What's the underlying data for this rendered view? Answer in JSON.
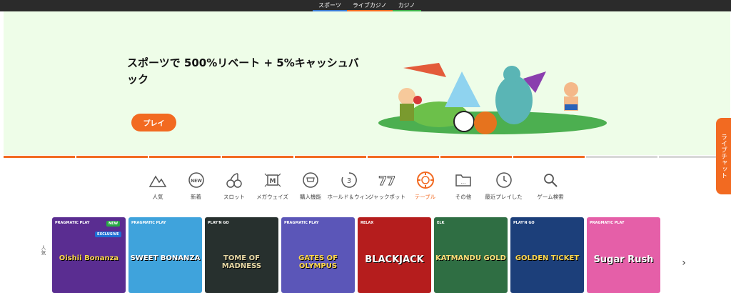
{
  "topnav": [
    {
      "label": "スポーツ"
    },
    {
      "label": "ライブカジノ"
    },
    {
      "label": "カジノ"
    }
  ],
  "banner": {
    "title": "スポーツで 500%リベート + 5%キャッシュバック",
    "play_label": "プレイ"
  },
  "live_chat_label": "ライブチャット",
  "categories": [
    {
      "label": "人気",
      "icon": "mountain-icon"
    },
    {
      "label": "新着",
      "icon": "new-badge-icon"
    },
    {
      "label": "スロット",
      "icon": "cherry-icon"
    },
    {
      "label": "メガウェイズ",
      "icon": "megaways-icon"
    },
    {
      "label": "購入機能",
      "icon": "cart-icon"
    },
    {
      "label": "ホールド＆ウィン",
      "icon": "hold-win-icon"
    },
    {
      "label": "ジャックポット",
      "icon": "seven-icon"
    },
    {
      "label": "テーブル",
      "icon": "chip-icon",
      "active": true
    },
    {
      "label": "その他",
      "icon": "folder-icon"
    },
    {
      "label": "最近プレイした",
      "icon": "clock-icon"
    },
    {
      "label": "ゲーム検索",
      "icon": "search-icon"
    }
  ],
  "side_label": "人気",
  "games": [
    {
      "provider": "PRAGMATIC PLAY",
      "badge": "NEW",
      "exclusive": "EXCLUSIVE",
      "title": "Oishii Bonanza",
      "bg": "#5a2d91"
    },
    {
      "provider": "PRAGMATIC PLAY",
      "title": "SWEET BONANZA",
      "bg": "#3fa3dc"
    },
    {
      "provider": "PLAY'N GO",
      "title": "TOME OF MADNESS",
      "bg": "#27302e"
    },
    {
      "provider": "PRAGMATIC PLAY",
      "title": "GATES OF OLYMPUS",
      "bg": "#5b56b8"
    },
    {
      "provider": "RELAX",
      "title": "BLACKJACK",
      "bg": "#b51d1d"
    },
    {
      "provider": "ELK",
      "title": "KATMANDU GOLD",
      "bg": "#2f6e43"
    },
    {
      "provider": "PLAY'N GO",
      "title": "GOLDEN TICKET",
      "bg": "#1c3f7a"
    },
    {
      "provider": "PRAGMATIC PLAY",
      "title": "Sugar Rush",
      "bg": "#e55fa8"
    }
  ],
  "progress": {
    "segments": 10,
    "active": 8
  }
}
